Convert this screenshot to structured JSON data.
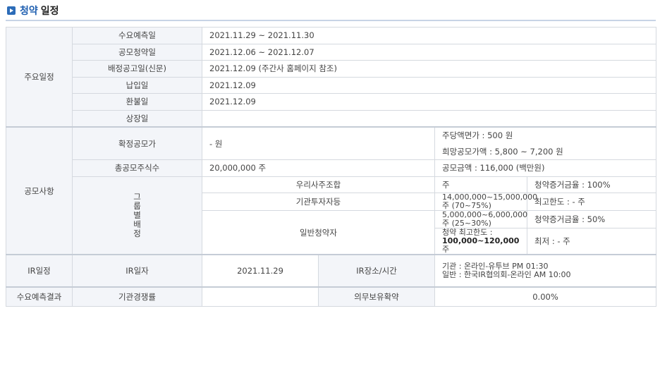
{
  "header": {
    "title_blue": "청약",
    "title_black": "일정"
  },
  "schedule": {
    "section": "주요일정",
    "rows": [
      {
        "label": "수요예측일",
        "value": "2021.11.29  ~  2021.11.30"
      },
      {
        "label": "공모청약일",
        "value": "2021.12.06  ~  2021.12.07"
      },
      {
        "label": "배정공고일(신문)",
        "value": "2021.12.09 (주간사 홈페이지 참조)"
      },
      {
        "label": "납입일",
        "value": "2021.12.09"
      },
      {
        "label": "환불일",
        "value": "2021.12.09"
      },
      {
        "label": "상장일",
        "value": ""
      }
    ]
  },
  "offering": {
    "section": "공모사항",
    "price_label": "확정공모가",
    "price_value": "- 원",
    "par_value": "주당액면가 :  500 원",
    "hope_price": "희망공모가액 :  5,800 ~ 7,200 원",
    "shares_label": "총공모주식수",
    "shares_value": "20,000,000 주",
    "total_amount": "공모금액 : 116,000 (백만원)",
    "group_label": "그룹별배정",
    "groups": [
      {
        "name": "우리사주조합",
        "qty": "주",
        "note": "청약증거금율 : 100%"
      },
      {
        "name": "기관투자자등",
        "qty": "14,000,000~15,000,000 주 (70~75%)",
        "note": "최고한도 :  - 주"
      },
      {
        "name": "일반청약자",
        "qty": "5,000,000~6,000,000 주 (25~30%)",
        "note": "청약증거금율 : 50%",
        "limit_prefix": "청약 최고한도 :",
        "limit_value": "100,000~120,000",
        "limit_unit": "주",
        "note2": "최저 :  - 주"
      }
    ]
  },
  "ir": {
    "section": "IR일정",
    "date_label": "IR일자",
    "date_value": "2021.11.29",
    "place_label": "IR장소/시간",
    "place_line1": "기관 : 온라인-유투브 PM 01:30",
    "place_line2": "일반 : 한국IR협의회-온라인 AM 10:00"
  },
  "demand": {
    "section": "수요예측결과",
    "comp_label": "기관경쟁률",
    "comp_value": "",
    "lockup_label": "의무보유확약",
    "lockup_value": "0.00%"
  }
}
